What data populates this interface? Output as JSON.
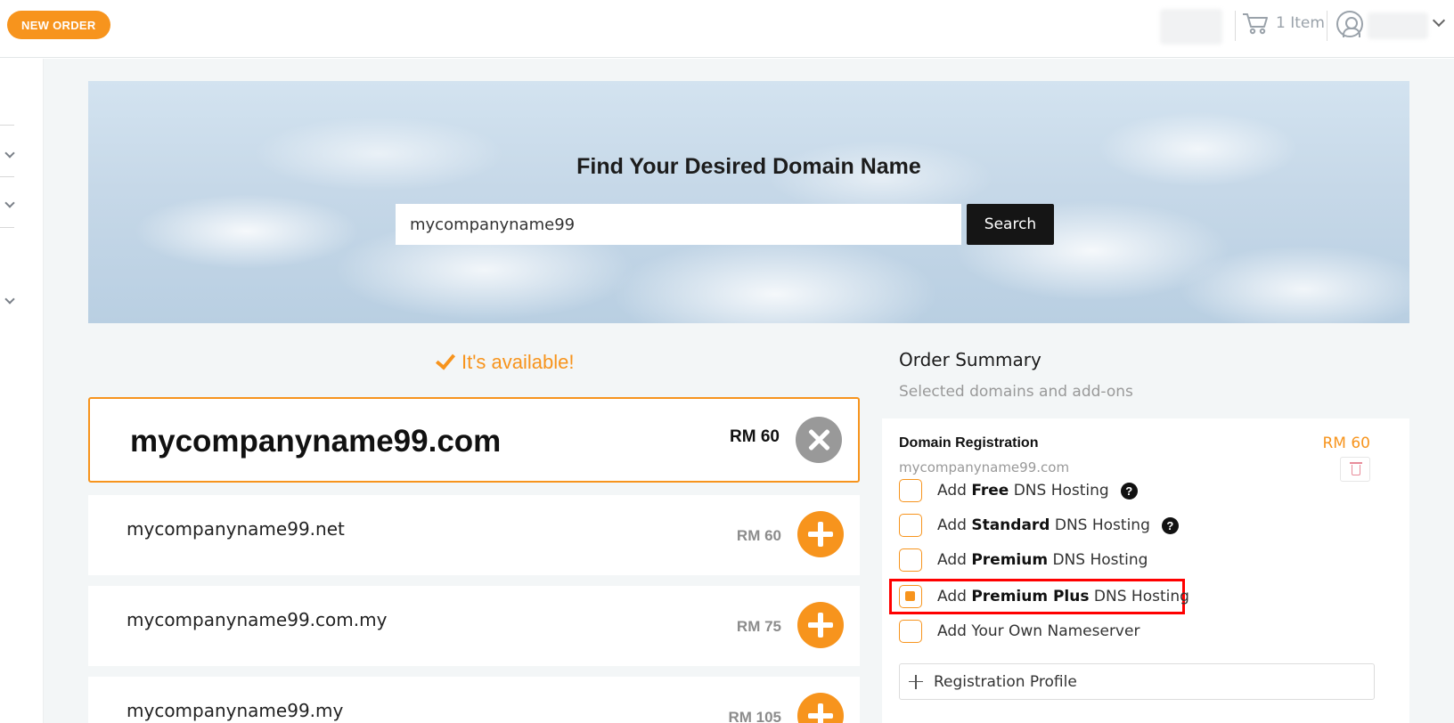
{
  "header": {
    "new_order_label": "NEW ORDER",
    "cart_label": "1 Item"
  },
  "search": {
    "title": "Find Your Desired Domain Name",
    "value": "mycompanyname99",
    "button_label": "Search"
  },
  "results": {
    "status": "It's available!",
    "primary": {
      "name": "mycompanyname99.com",
      "price": "RM 60"
    },
    "alternatives": [
      {
        "name": "mycompanyname99.net",
        "price": "RM 60"
      },
      {
        "name": "mycompanyname99.com.my",
        "price": "RM 75"
      },
      {
        "name": "mycompanyname99.my",
        "price": "RM 105"
      }
    ]
  },
  "order_summary": {
    "title": "Order Summary",
    "subtitle": "Selected domains and add-ons",
    "registration_title": "Domain Registration",
    "registration_price": "RM 60",
    "registration_domain": "mycompanyname99.com",
    "options": [
      {
        "prefix": "Add ",
        "bold": "Free",
        "suffix": " DNS Hosting",
        "checked": false,
        "help": true
      },
      {
        "prefix": "Add ",
        "bold": "Standard",
        "suffix": " DNS Hosting",
        "checked": false,
        "help": true
      },
      {
        "prefix": "Add ",
        "bold": "Premium",
        "suffix": " DNS Hosting",
        "checked": false,
        "help": false
      },
      {
        "prefix": "Add ",
        "bold": "Premium Plus",
        "suffix": " DNS Hosting",
        "checked": true,
        "help": false
      },
      {
        "prefix": "Add Your Own Nameserver",
        "bold": "",
        "suffix": "",
        "checked": false,
        "help": false
      }
    ],
    "help_glyph": "?",
    "registration_profile_label": "Registration Profile"
  },
  "colors": {
    "accent": "#f7941d",
    "highlight": "#ff0000",
    "search_button": "#151515"
  }
}
